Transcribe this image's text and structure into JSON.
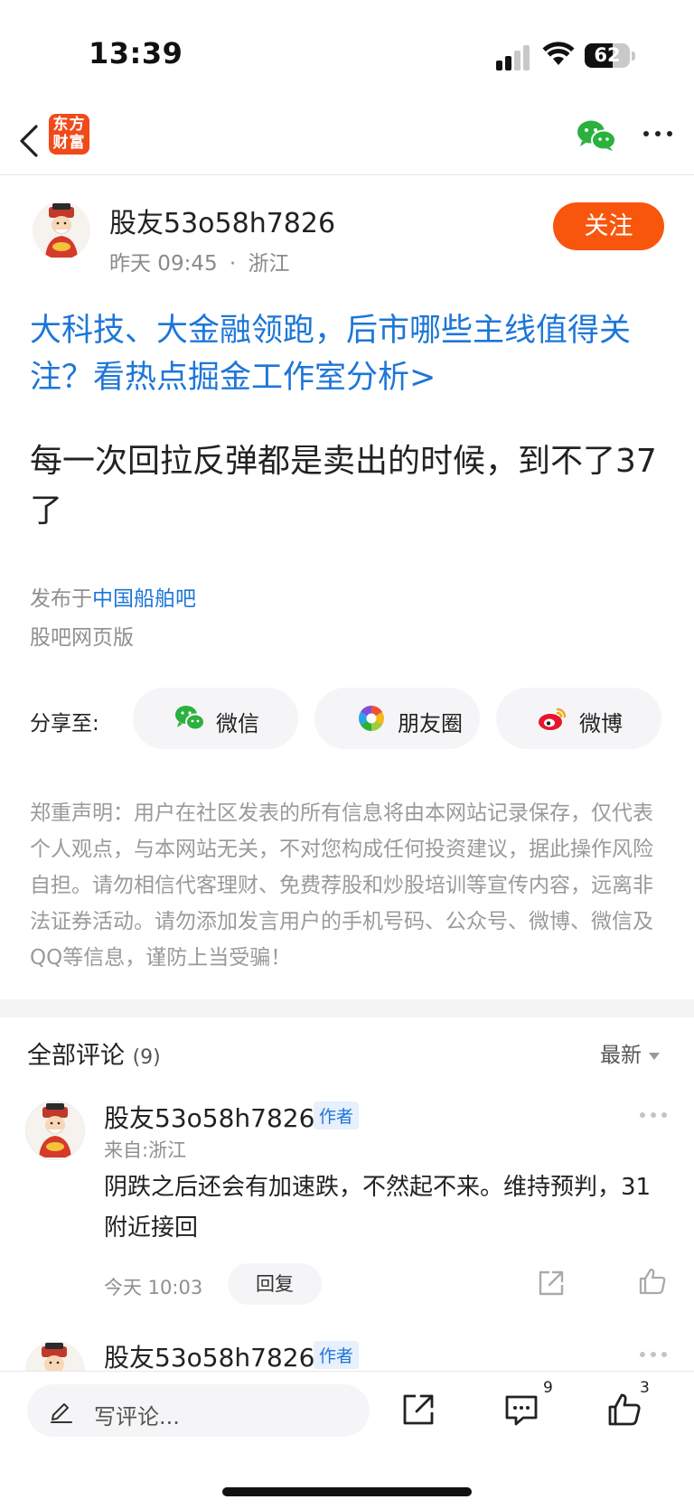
{
  "status_bar": {
    "time": "13:39",
    "battery": "62",
    "battery_level": 0.62
  },
  "nav": {
    "logo_line1": "东方",
    "logo_line2": "财富"
  },
  "post": {
    "author": "股友53o58h7826",
    "time": "昨天 09:45",
    "separator": "·",
    "location": "浙江",
    "follow_label": "关注",
    "promo_link": "大科技、大金融领跑，后市哪些主线值得关注？看热点掘金工作室分析>",
    "body": "每一次回拉反弹都是卖出的时候，到不了37了",
    "published_prefix": "发布于",
    "forum": "中国船舶吧",
    "web_version": "股吧网页版"
  },
  "share": {
    "label": "分享至:",
    "options": [
      {
        "label": "微信",
        "icon": "wechat-icon"
      },
      {
        "label": "朋友圈",
        "icon": "moments-icon"
      },
      {
        "label": "微博",
        "icon": "weibo-icon"
      }
    ]
  },
  "disclaimer": "郑重声明：用户在社区发表的所有信息将由本网站记录保存，仅代表个人观点，与本网站无关，不对您构成任何投资建议，据此操作风险自担。请勿相信代客理财、免费荐股和炒股培训等宣传内容，远离非法证券活动。请勿添加发言用户的手机号码、公众号、微博、微信及QQ等信息，谨防上当受骗！",
  "comments": {
    "title": "全部评论",
    "count": "(9)",
    "sort": "最新",
    "items": [
      {
        "author": "股友53o58h7826",
        "badge": "作者",
        "location": "来自:浙江",
        "text": "阴跌之后还会有加速跌，不然起不来。维持预判，31附近接回",
        "time": "今天 10:03",
        "reply_label": "回复"
      },
      {
        "author": "股友53o58h7826",
        "badge": "作者"
      }
    ]
  },
  "bottom_bar": {
    "placeholder": "写评论...",
    "comment_count": "9",
    "like_count": "3"
  },
  "colors": {
    "brand_orange": "#f8560d",
    "link_blue": "#1d76d8",
    "wechat_green": "#2ab13e"
  }
}
